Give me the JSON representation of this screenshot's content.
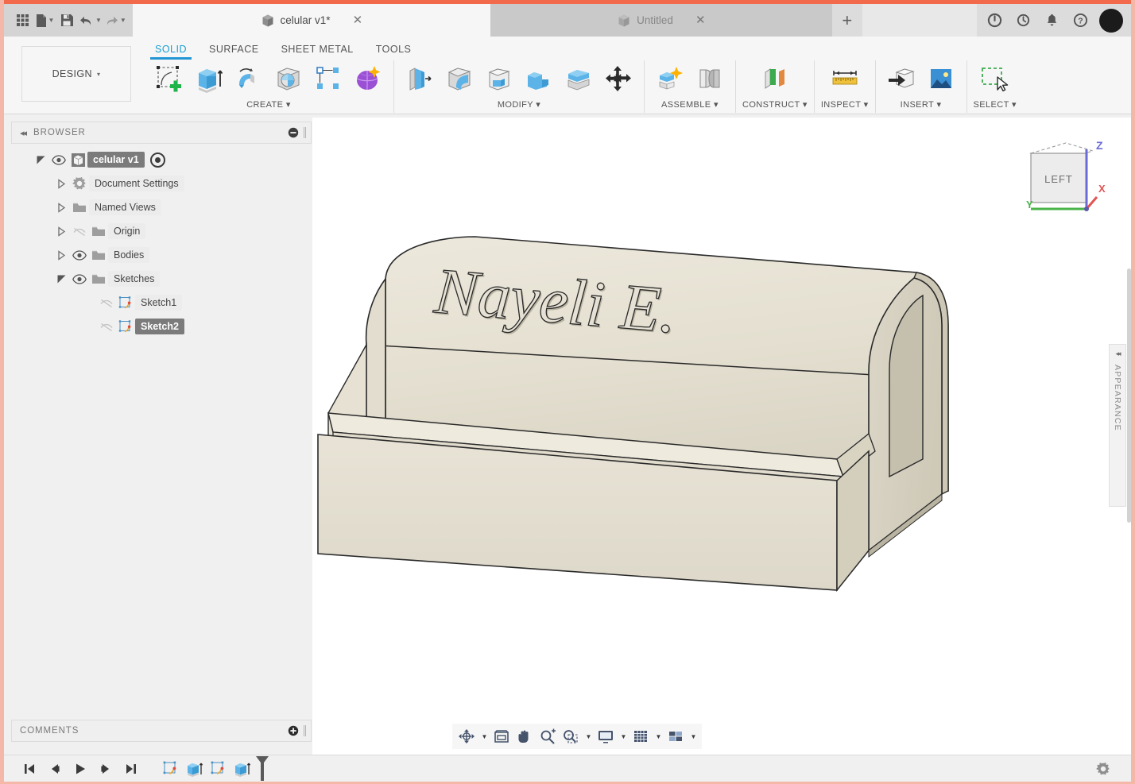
{
  "app": {
    "accent_color": "#f26a4b",
    "active_tab_color": "#2196d3"
  },
  "quick_access": {
    "items": [
      {
        "name": "app-grid",
        "label": "App Grid"
      },
      {
        "name": "new-file",
        "label": "New"
      },
      {
        "name": "save",
        "label": "Save"
      },
      {
        "name": "undo",
        "label": "Undo"
      },
      {
        "name": "redo",
        "label": "Redo"
      }
    ]
  },
  "document_tabs": [
    {
      "label": "celular v1*",
      "active": true,
      "close": "✕"
    },
    {
      "label": "Untitled",
      "active": false,
      "close": "✕"
    }
  ],
  "tab_add_label": "+",
  "title_right": {
    "items": [
      {
        "name": "job-status-icon",
        "label": "Job Status"
      },
      {
        "name": "recent-activity-icon",
        "label": "Recent"
      },
      {
        "name": "notifications-icon",
        "label": "Notifications"
      },
      {
        "name": "help-icon",
        "label": "Help"
      }
    ],
    "avatar_label": "Account"
  },
  "ribbon": {
    "design_label": "DESIGN",
    "design_caret": "▾",
    "workspace_tabs": [
      {
        "label": "SOLID",
        "active": true
      },
      {
        "label": "SURFACE",
        "active": false
      },
      {
        "label": "SHEET METAL",
        "active": false
      },
      {
        "label": "TOOLS",
        "active": false
      }
    ],
    "panels": [
      {
        "label": "CREATE",
        "caret": "▾",
        "tools": [
          {
            "name": "create-sketch-icon",
            "label": "Create Sketch"
          },
          {
            "name": "extrude-icon",
            "label": "Extrude"
          },
          {
            "name": "revolve-icon",
            "label": "Revolve"
          },
          {
            "name": "hole-icon",
            "label": "Hole"
          },
          {
            "name": "rectangular-pattern-icon",
            "label": "Rectangular Pattern"
          },
          {
            "name": "form-icon",
            "label": "Create Form"
          }
        ]
      },
      {
        "label": "MODIFY",
        "caret": "▾",
        "tools": [
          {
            "name": "press-pull-icon",
            "label": "Press Pull"
          },
          {
            "name": "fillet-icon",
            "label": "Fillet"
          },
          {
            "name": "shell-icon",
            "label": "Shell"
          },
          {
            "name": "combine-icon",
            "label": "Combine"
          },
          {
            "name": "split-face-icon",
            "label": "Split Face"
          },
          {
            "name": "move-copy-icon",
            "label": "Move/Copy"
          }
        ]
      },
      {
        "label": "ASSEMBLE",
        "caret": "▾",
        "tools": [
          {
            "name": "new-component-icon",
            "label": "New Component"
          },
          {
            "name": "joint-icon",
            "label": "Joint"
          }
        ]
      },
      {
        "label": "CONSTRUCT",
        "caret": "▾",
        "tools": [
          {
            "name": "offset-plane-icon",
            "label": "Offset Plane"
          }
        ]
      },
      {
        "label": "INSPECT",
        "caret": "▾",
        "tools": [
          {
            "name": "measure-icon",
            "label": "Measure"
          }
        ]
      },
      {
        "label": "INSERT",
        "caret": "▾",
        "tools": [
          {
            "name": "insert-derive-icon",
            "label": "Derive"
          },
          {
            "name": "insert-canvas-icon",
            "label": "Canvas"
          }
        ]
      },
      {
        "label": "SELECT",
        "caret": "▾",
        "tools": [
          {
            "name": "select-window-icon",
            "label": "Select"
          }
        ]
      }
    ]
  },
  "browser": {
    "title": "BROWSER",
    "collapse_glyph": "◂◂",
    "minus_glyph": "⊖",
    "root": {
      "label": "celular v1",
      "selected": true
    },
    "items": [
      {
        "label": "Document Settings",
        "icon": "gear-icon",
        "expander": "collapsed",
        "eye": "none",
        "selected": false,
        "indent": 1
      },
      {
        "label": "Named Views",
        "icon": "folder-icon",
        "expander": "collapsed",
        "eye": "none",
        "selected": false,
        "indent": 1
      },
      {
        "label": "Origin",
        "icon": "folder-icon",
        "expander": "collapsed",
        "eye": "hidden",
        "selected": false,
        "indent": 1
      },
      {
        "label": "Bodies",
        "icon": "folder-icon",
        "expander": "collapsed",
        "eye": "visible",
        "selected": false,
        "indent": 1
      },
      {
        "label": "Sketches",
        "icon": "folder-icon",
        "expander": "expanded",
        "eye": "visible",
        "selected": false,
        "indent": 1
      },
      {
        "label": "Sketch1",
        "icon": "sketch-icon",
        "expander": "none",
        "eye": "hidden",
        "selected": false,
        "indent": 2
      },
      {
        "label": "Sketch2",
        "icon": "sketch-icon",
        "expander": "none",
        "eye": "hidden",
        "selected": true,
        "indent": 2
      }
    ]
  },
  "comments": {
    "title": "COMMENTS",
    "add_glyph": "⊕"
  },
  "canvas": {
    "model_text": "Nayeli E.",
    "model_name": "phone-stand-body",
    "background": "#ffffff",
    "material_color": "#e6e1d4",
    "viewcube": {
      "face_label": "LEFT",
      "axes": [
        {
          "label": "Z",
          "color": "#6b6bd6"
        },
        {
          "label": "Y",
          "color": "#49b349"
        },
        {
          "label": "X",
          "color": "#e05555"
        }
      ]
    },
    "appearance_panel": {
      "label": "APPEARANCE",
      "collapse_glyph": "◂◂"
    }
  },
  "navbar": {
    "items": [
      {
        "name": "orbit-icon",
        "label": "Orbit",
        "caret": "▾"
      },
      {
        "name": "fit-icon",
        "label": "Fit",
        "caret": ""
      },
      {
        "name": "pan-icon",
        "label": "Pan",
        "caret": ""
      },
      {
        "name": "zoom-icon",
        "label": "Zoom",
        "caret": ""
      },
      {
        "name": "zoom-window-icon",
        "label": "Zoom Window",
        "caret": "▾"
      },
      {
        "name": "display-settings-icon",
        "label": "Display Settings",
        "caret": "▾"
      },
      {
        "name": "grid-snaps-icon",
        "label": "Grid and Snaps",
        "caret": "▾"
      },
      {
        "name": "viewports-icon",
        "label": "Viewports",
        "caret": "▾"
      }
    ]
  },
  "timeline": {
    "playback": [
      {
        "name": "go-to-beginning-icon",
        "label": "Go to Beginning"
      },
      {
        "name": "step-back-icon",
        "label": "Step Back"
      },
      {
        "name": "play-icon",
        "label": "Play"
      },
      {
        "name": "step-forward-icon",
        "label": "Step Forward"
      },
      {
        "name": "go-to-end-icon",
        "label": "Go to End"
      }
    ],
    "features": [
      {
        "name": "timeline-sketch1",
        "label": "Sketch1",
        "type": "sketch"
      },
      {
        "name": "timeline-extrude1",
        "label": "Extrude1",
        "type": "extrude"
      },
      {
        "name": "timeline-sketch2",
        "label": "Sketch2",
        "type": "sketch"
      },
      {
        "name": "timeline-extrude2",
        "label": "Extrude2",
        "type": "extrude"
      }
    ],
    "marker_label": "Timeline Marker",
    "settings_label": "Settings"
  }
}
